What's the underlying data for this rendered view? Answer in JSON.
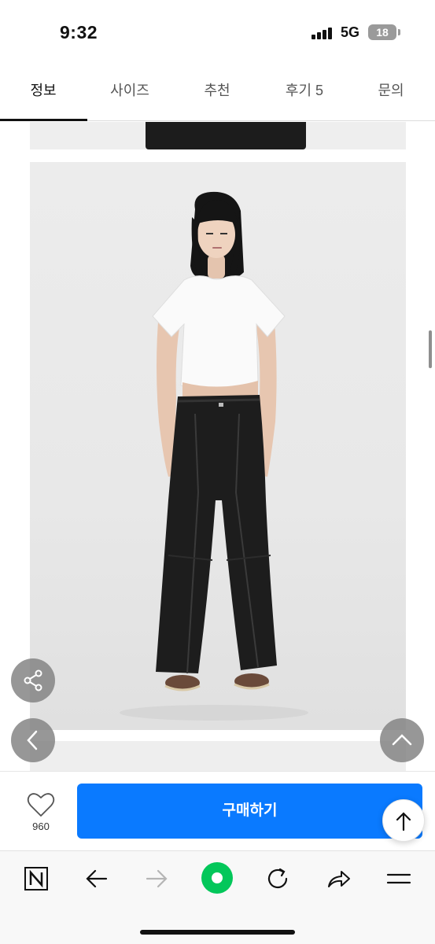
{
  "status_bar": {
    "time": "9:32",
    "network": "5G",
    "battery": "18"
  },
  "tabs": [
    {
      "label": "정보",
      "active": true
    },
    {
      "label": "사이즈",
      "active": false
    },
    {
      "label": "추천",
      "active": false
    },
    {
      "label": "후기 5",
      "active": false
    },
    {
      "label": "문의",
      "active": false
    }
  ],
  "purchase_bar": {
    "like_count": "960",
    "buy_label": "구매하기"
  },
  "icons": {
    "share": "share-icon",
    "prev": "chevron-left-icon",
    "up": "chevron-up-icon",
    "heart": "heart-icon",
    "top": "arrow-up-icon",
    "naver": "n-logo-icon",
    "back": "arrow-left-icon",
    "forward": "arrow-right-icon",
    "green": "green-circle-icon",
    "reload": "reload-icon",
    "share_tb": "share-arrow-icon",
    "menu": "menu-icon"
  },
  "colors": {
    "accent": "#0a7aff",
    "green": "#03c75a"
  }
}
